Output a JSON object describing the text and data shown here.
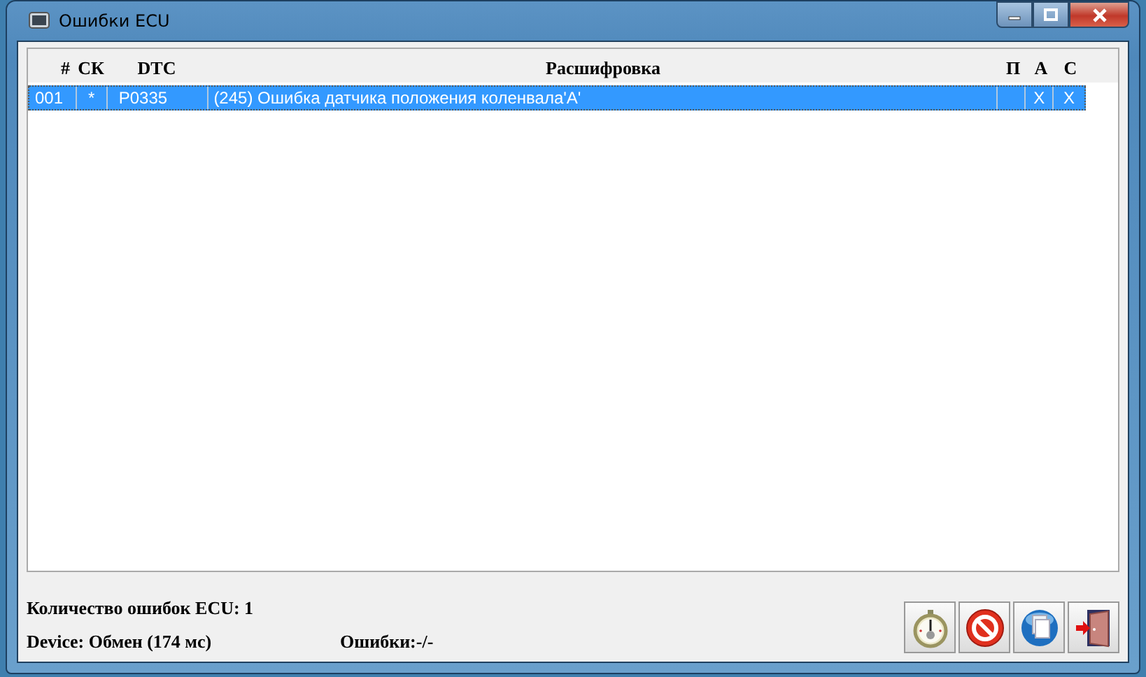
{
  "window": {
    "title": "Ошибки ECU"
  },
  "table": {
    "columns": [
      "#",
      "СК",
      "DTC",
      "Расшифровка",
      "П",
      "А",
      "С"
    ],
    "rows": [
      {
        "selected": true,
        "cells": [
          "001",
          "*",
          "P0335",
          "(245) Ошибка датчика положения коленвала'A'",
          "",
          "X",
          "X"
        ]
      }
    ]
  },
  "status": {
    "count": "Количество ошибок ECU: 1",
    "device": "Device: Обмен (174 мс)",
    "errors": "Ошибки:-/-"
  },
  "buttons": [
    {
      "kind": "stopwatch"
    },
    {
      "kind": "stop"
    },
    {
      "kind": "copy"
    },
    {
      "kind": "exit"
    }
  ]
}
